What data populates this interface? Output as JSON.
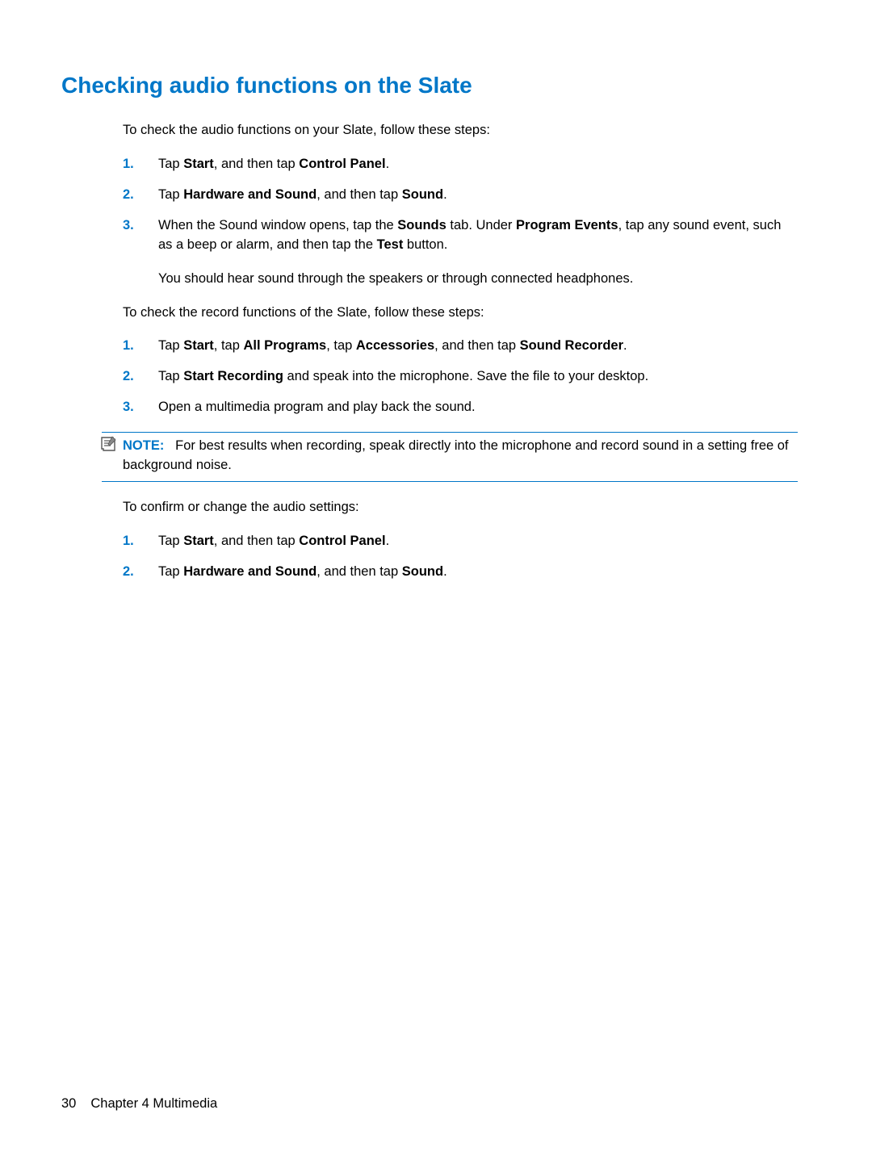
{
  "heading": "Checking audio functions on the Slate",
  "intro1": "To check the audio functions on your Slate, follow these steps:",
  "list1": [
    {
      "n": "1.",
      "html": "Tap <b>Start</b>, and then tap <b>Control Panel</b>."
    },
    {
      "n": "2.",
      "html": "Tap <b>Hardware and Sound</b>, and then tap <b>Sound</b>."
    },
    {
      "n": "3.",
      "html": "When the Sound window opens, tap the <b>Sounds</b> tab. Under <b>Program Events</b>, tap any sound event, such as a beep or alarm, and then tap the <b>Test</b> button.",
      "sub": "You should hear sound through the speakers or through connected headphones."
    }
  ],
  "intro2": "To check the record functions of the Slate, follow these steps:",
  "list2": [
    {
      "n": "1.",
      "html": "Tap <b>Start</b>, tap <b>All Programs</b>, tap <b>Accessories</b>, and then tap <b>Sound Recorder</b>."
    },
    {
      "n": "2.",
      "html": "Tap <b>Start Recording</b> and speak into the microphone. Save the file to your desktop."
    },
    {
      "n": "3.",
      "html": "Open a multimedia program and play back the sound."
    }
  ],
  "note_label": "NOTE:",
  "note_text": "For best results when recording, speak directly into the microphone and record sound in a setting free of background noise.",
  "intro3": "To confirm or change the audio settings:",
  "list3": [
    {
      "n": "1.",
      "html": "Tap <b>Start</b>, and then tap <b>Control Panel</b>."
    },
    {
      "n": "2.",
      "html": "Tap <b>Hardware and Sound</b>, and then tap <b>Sound</b>."
    }
  ],
  "footer_page": "30",
  "footer_chapter": "Chapter 4   Multimedia"
}
